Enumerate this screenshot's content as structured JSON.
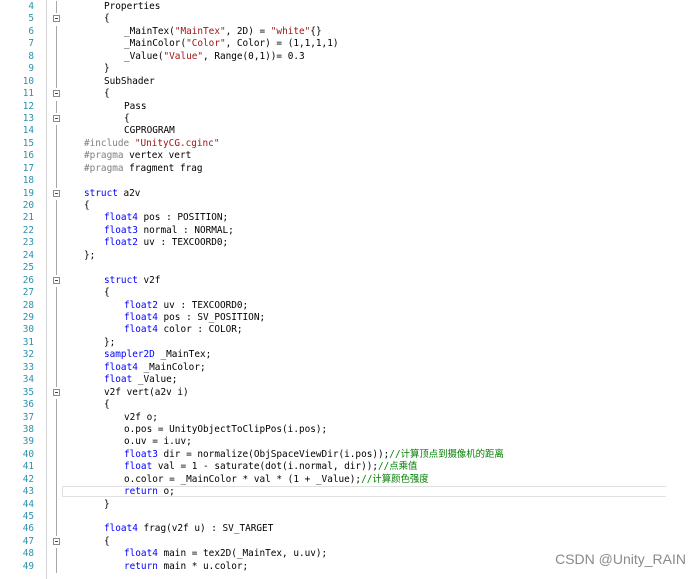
{
  "editor": {
    "lines": [
      {
        "n": "4",
        "fold": "",
        "indent": 20,
        "tokens": [
          {
            "t": "txt",
            "v": "Properties"
          }
        ]
      },
      {
        "n": "5",
        "fold": "open",
        "indent": 20,
        "tokens": [
          {
            "t": "txt",
            "v": "{"
          }
        ]
      },
      {
        "n": "6",
        "fold": "",
        "indent": 40,
        "tokens": [
          {
            "t": "txt",
            "v": "_MainTex("
          },
          {
            "t": "str",
            "v": "\"MainTex\""
          },
          {
            "t": "txt",
            "v": ", 2D) = "
          },
          {
            "t": "str",
            "v": "\"white\""
          },
          {
            "t": "txt",
            "v": "{}"
          }
        ]
      },
      {
        "n": "7",
        "fold": "",
        "indent": 40,
        "tokens": [
          {
            "t": "txt",
            "v": "_MainColor("
          },
          {
            "t": "str",
            "v": "\"Color\""
          },
          {
            "t": "txt",
            "v": ", Color) = (1,1,1,1)"
          }
        ]
      },
      {
        "n": "8",
        "fold": "",
        "indent": 40,
        "tokens": [
          {
            "t": "txt",
            "v": "_Value("
          },
          {
            "t": "str",
            "v": "\"Value\""
          },
          {
            "t": "txt",
            "v": ", Range(0,1))= 0.3"
          }
        ]
      },
      {
        "n": "9",
        "fold": "",
        "indent": 20,
        "tokens": [
          {
            "t": "txt",
            "v": "}"
          }
        ]
      },
      {
        "n": "10",
        "fold": "",
        "indent": 20,
        "tokens": [
          {
            "t": "txt",
            "v": "SubShader"
          }
        ]
      },
      {
        "n": "11",
        "fold": "open",
        "indent": 20,
        "tokens": [
          {
            "t": "txt",
            "v": "{"
          }
        ]
      },
      {
        "n": "12",
        "fold": "",
        "indent": 40,
        "tokens": [
          {
            "t": "txt",
            "v": "Pass"
          }
        ]
      },
      {
        "n": "13",
        "fold": "open",
        "indent": 40,
        "tokens": [
          {
            "t": "txt",
            "v": "{"
          }
        ]
      },
      {
        "n": "14",
        "fold": "",
        "indent": 40,
        "tokens": [
          {
            "t": "txt",
            "v": "CGPROGRAM"
          }
        ]
      },
      {
        "n": "15",
        "fold": "",
        "indent": 0,
        "tokens": [
          {
            "t": "pp",
            "v": "#include "
          },
          {
            "t": "str",
            "v": "\"UnityCG.cginc\""
          }
        ]
      },
      {
        "n": "16",
        "fold": "",
        "indent": 0,
        "tokens": [
          {
            "t": "pp",
            "v": "#pragma "
          },
          {
            "t": "txt",
            "v": "vertex vert"
          }
        ]
      },
      {
        "n": "17",
        "fold": "",
        "indent": 0,
        "tokens": [
          {
            "t": "pp",
            "v": "#pragma "
          },
          {
            "t": "txt",
            "v": "fragment frag"
          }
        ]
      },
      {
        "n": "18",
        "fold": "",
        "indent": 0,
        "tokens": []
      },
      {
        "n": "19",
        "fold": "open",
        "indent": 0,
        "tokens": [
          {
            "t": "kw",
            "v": "struct "
          },
          {
            "t": "txt",
            "v": "a2v"
          }
        ]
      },
      {
        "n": "20",
        "fold": "",
        "indent": 0,
        "tokens": [
          {
            "t": "txt",
            "v": "{"
          }
        ]
      },
      {
        "n": "21",
        "fold": "",
        "indent": 20,
        "tokens": [
          {
            "t": "kw",
            "v": "float4 "
          },
          {
            "t": "txt",
            "v": "pos : POSITION;"
          }
        ]
      },
      {
        "n": "22",
        "fold": "",
        "indent": 20,
        "tokens": [
          {
            "t": "kw",
            "v": "float3 "
          },
          {
            "t": "txt",
            "v": "normal : NORMAL;"
          }
        ]
      },
      {
        "n": "23",
        "fold": "",
        "indent": 20,
        "tokens": [
          {
            "t": "kw",
            "v": "float2 "
          },
          {
            "t": "txt",
            "v": "uv : TEXCOORD0;"
          }
        ]
      },
      {
        "n": "24",
        "fold": "",
        "indent": 0,
        "tokens": [
          {
            "t": "txt",
            "v": "};"
          }
        ]
      },
      {
        "n": "25",
        "fold": "",
        "indent": 0,
        "tokens": []
      },
      {
        "n": "26",
        "fold": "open",
        "indent": 20,
        "tokens": [
          {
            "t": "kw",
            "v": "struct "
          },
          {
            "t": "txt",
            "v": "v2f"
          }
        ]
      },
      {
        "n": "27",
        "fold": "",
        "indent": 20,
        "tokens": [
          {
            "t": "txt",
            "v": "{"
          }
        ]
      },
      {
        "n": "28",
        "fold": "",
        "indent": 40,
        "tokens": [
          {
            "t": "kw",
            "v": "float2 "
          },
          {
            "t": "txt",
            "v": "uv : TEXCOORD0;"
          }
        ]
      },
      {
        "n": "29",
        "fold": "",
        "indent": 40,
        "tokens": [
          {
            "t": "kw",
            "v": "float4 "
          },
          {
            "t": "txt",
            "v": "pos : SV_POSITION;"
          }
        ]
      },
      {
        "n": "30",
        "fold": "",
        "indent": 40,
        "tokens": [
          {
            "t": "kw",
            "v": "float4 "
          },
          {
            "t": "txt",
            "v": "color : COLOR;"
          }
        ]
      },
      {
        "n": "31",
        "fold": "",
        "indent": 20,
        "tokens": [
          {
            "t": "txt",
            "v": "};"
          }
        ]
      },
      {
        "n": "32",
        "fold": "",
        "indent": 20,
        "tokens": [
          {
            "t": "kw",
            "v": "sampler2D "
          },
          {
            "t": "txt",
            "v": "_MainTex;"
          }
        ]
      },
      {
        "n": "33",
        "fold": "",
        "indent": 20,
        "tokens": [
          {
            "t": "kw",
            "v": "float4 "
          },
          {
            "t": "txt",
            "v": "_MainColor;"
          }
        ]
      },
      {
        "n": "34",
        "fold": "",
        "indent": 20,
        "tokens": [
          {
            "t": "kw",
            "v": "float "
          },
          {
            "t": "txt",
            "v": "_Value;"
          }
        ]
      },
      {
        "n": "35",
        "fold": "open",
        "indent": 20,
        "tokens": [
          {
            "t": "txt",
            "v": "v2f vert(a2v i)"
          }
        ]
      },
      {
        "n": "36",
        "fold": "",
        "indent": 20,
        "tokens": [
          {
            "t": "txt",
            "v": "{"
          }
        ]
      },
      {
        "n": "37",
        "fold": "",
        "indent": 40,
        "tokens": [
          {
            "t": "txt",
            "v": "v2f o;"
          }
        ]
      },
      {
        "n": "38",
        "fold": "",
        "indent": 40,
        "tokens": [
          {
            "t": "txt",
            "v": "o.pos = UnityObjectToClipPos(i.pos);"
          }
        ]
      },
      {
        "n": "39",
        "fold": "",
        "indent": 40,
        "tokens": [
          {
            "t": "txt",
            "v": "o.uv = i.uv;"
          }
        ]
      },
      {
        "n": "40",
        "fold": "",
        "indent": 40,
        "tokens": [
          {
            "t": "kw",
            "v": "float3 "
          },
          {
            "t": "txt",
            "v": "dir = normalize(ObjSpaceViewDir(i.pos));"
          },
          {
            "t": "cm",
            "v": "//计算顶点到摄像机的距离"
          }
        ]
      },
      {
        "n": "41",
        "fold": "",
        "indent": 40,
        "tokens": [
          {
            "t": "kw",
            "v": "float "
          },
          {
            "t": "txt",
            "v": "val = 1 - saturate(dot(i.normal, dir));"
          },
          {
            "t": "cm",
            "v": "//点乘值"
          }
        ]
      },
      {
        "n": "42",
        "fold": "",
        "indent": 40,
        "tokens": [
          {
            "t": "txt",
            "v": "o.color = _MainColor * val * (1 + _Value);"
          },
          {
            "t": "cm",
            "v": "//计算颜色强度"
          }
        ]
      },
      {
        "n": "43",
        "fold": "",
        "indent": 40,
        "tokens": [
          {
            "t": "kw",
            "v": "return "
          },
          {
            "t": "txt",
            "v": "o;"
          }
        ]
      },
      {
        "n": "44",
        "fold": "",
        "indent": 20,
        "tokens": [
          {
            "t": "txt",
            "v": "}"
          }
        ]
      },
      {
        "n": "45",
        "fold": "",
        "indent": 0,
        "tokens": []
      },
      {
        "n": "46",
        "fold": "",
        "indent": 20,
        "tokens": [
          {
            "t": "kw",
            "v": "float4 "
          },
          {
            "t": "txt",
            "v": "frag(v2f u) : SV_TARGET"
          }
        ]
      },
      {
        "n": "47",
        "fold": "open",
        "indent": 20,
        "tokens": [
          {
            "t": "txt",
            "v": "{"
          }
        ]
      },
      {
        "n": "48",
        "fold": "",
        "indent": 40,
        "tokens": [
          {
            "t": "kw",
            "v": "float4 "
          },
          {
            "t": "txt",
            "v": "main = tex2D(_MainTex, u.uv);"
          }
        ]
      },
      {
        "n": "49",
        "fold": "",
        "indent": 40,
        "tokens": [
          {
            "t": "kw",
            "v": "return "
          },
          {
            "t": "txt",
            "v": "main * u.color;"
          }
        ]
      }
    ]
  },
  "watermark": "CSDN @Unity_RAIN"
}
